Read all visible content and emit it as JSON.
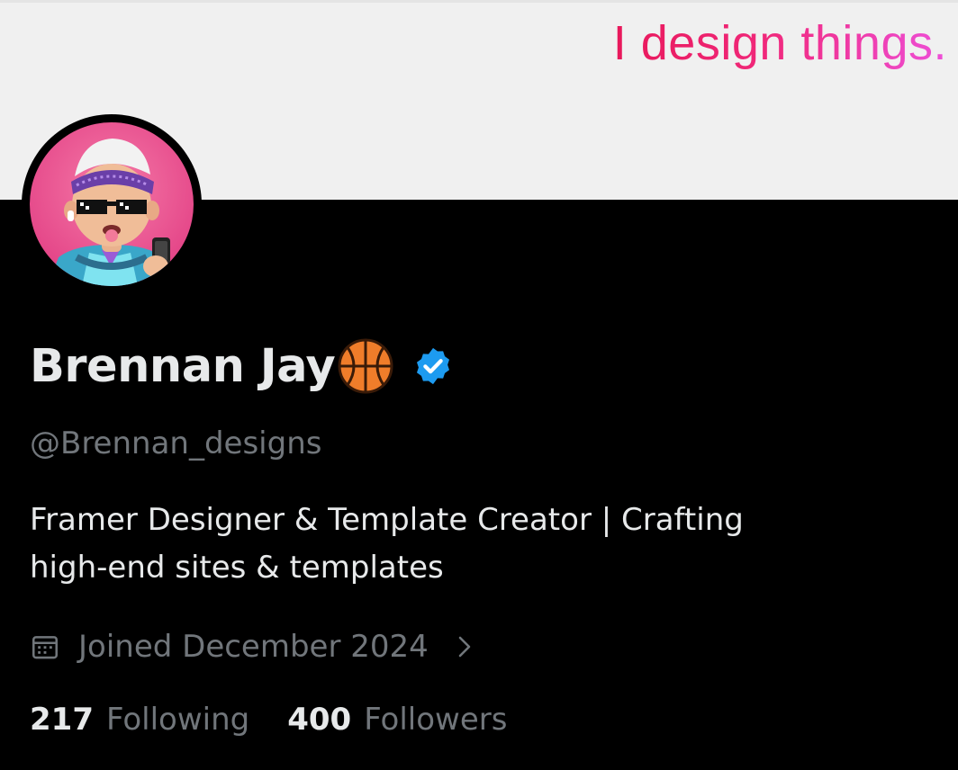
{
  "banner": {
    "tagline": "I design things."
  },
  "profile": {
    "display_name": "Brennan Jay",
    "name_emoji_icon": "basketball-icon",
    "verified_icon": "verified-badge-icon",
    "handle": "@Brennan_designs",
    "bio_line_1": "Framer Designer & Template Creator | Crafting",
    "bio_line_2": "high-end sites & templates",
    "joined_icon": "calendar-icon",
    "joined": "Joined December 2024",
    "joined_chevron_icon": "chevron-right-icon"
  },
  "stats": {
    "following_count": "217",
    "following_label": "Following",
    "followers_count": "400",
    "followers_label": "Followers"
  },
  "colors": {
    "background": "#000000",
    "banner_bg": "#f0f0f0",
    "tagline_gradient_start": "#e8185a",
    "tagline_gradient_end": "#ee4fd8",
    "primary_text": "#e7e9ea",
    "secondary_text": "#71767b",
    "verified_blue": "#1d9bf0",
    "avatar_bg": "#ec4d8f"
  }
}
